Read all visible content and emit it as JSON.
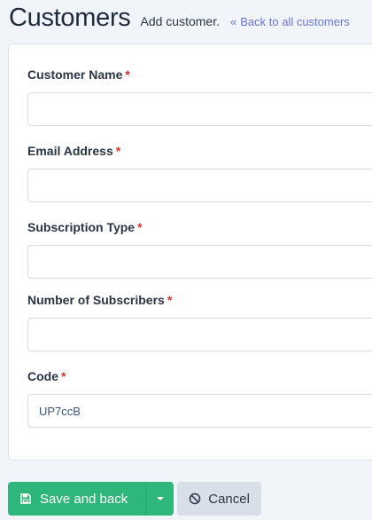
{
  "header": {
    "title": "Customers",
    "subtitle": "Add customer.",
    "back_link": "Back to all customers",
    "back_icon": "double-chevron-left-icon"
  },
  "form": {
    "fields": [
      {
        "label": "Customer Name",
        "required_mark": "*",
        "value": ""
      },
      {
        "label": "Email Address",
        "required_mark": "*",
        "value": ""
      },
      {
        "label": "Subscription Type",
        "required_mark": "*",
        "value": ""
      },
      {
        "label": "Number of Subscribers",
        "required_mark": "*",
        "value": ""
      },
      {
        "label": "Code",
        "required_mark": "*",
        "value": "UP7ccB"
      }
    ]
  },
  "footer": {
    "save_label": "Save and back",
    "save_icon": "floppy-disk-icon",
    "dropdown_icon": "caret-down-icon",
    "cancel_label": "Cancel",
    "cancel_icon": "ban-icon"
  },
  "colors": {
    "accent": "#6a74d9",
    "primary_button": "#2fb67a",
    "required": "#dc2f2f",
    "secondary_button": "#d9dfe8"
  }
}
